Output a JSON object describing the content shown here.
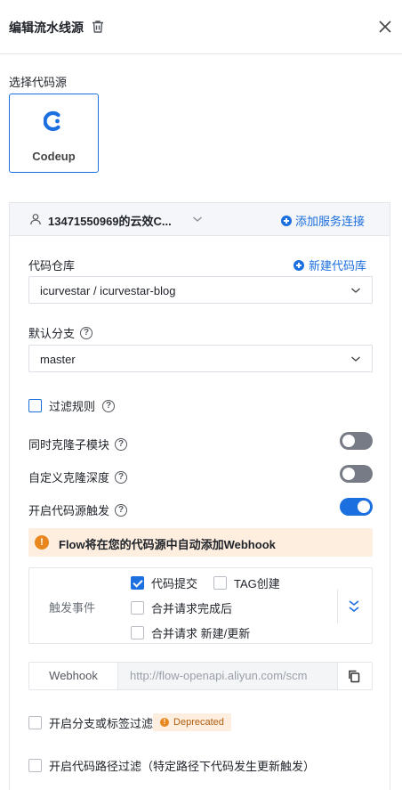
{
  "header": {
    "title": "编辑流水线源"
  },
  "source": {
    "section_label": "选择代码源",
    "selected_name": "Codeup"
  },
  "connection": {
    "account": "13471550969的云效C...",
    "add_service_label": "添加服务连接"
  },
  "repository": {
    "label": "代码仓库",
    "new_repo_label": "新建代码库",
    "value": "icurvestar / icurvestar-blog"
  },
  "branch": {
    "label": "默认分支",
    "value": "master"
  },
  "filter_rules": {
    "label": "过滤规则",
    "checked": false
  },
  "options": {
    "clone_submodules": {
      "label": "同时克隆子模块",
      "enabled": false
    },
    "custom_clone_depth": {
      "label": "自定义克隆深度",
      "enabled": false
    },
    "source_trigger": {
      "label": "开启代码源触发",
      "enabled": true
    }
  },
  "warning": {
    "text": "Flow将在您的代码源中自动添加Webhook"
  },
  "events": {
    "label": "触发事件",
    "items": [
      {
        "label": "代码提交",
        "checked": true
      },
      {
        "label": "TAG创建",
        "checked": false
      },
      {
        "label": "合并请求完成后",
        "checked": false
      },
      {
        "label": "合并请求 新建/更新",
        "checked": false
      }
    ]
  },
  "webhook": {
    "label": "Webhook",
    "url": "http://flow-openapi.aliyun.com/scm"
  },
  "branch_tag_filter": {
    "label": "开启分支或标签过滤",
    "badge": "Deprecated",
    "checked": false
  },
  "path_filter": {
    "label": "开启代码路径过滤（特定路径下代码发生更新触发）",
    "checked": false
  },
  "colors": {
    "accent": "#1b6fde",
    "warning": "#e9871e",
    "warning_bg": "#fdeedf"
  }
}
